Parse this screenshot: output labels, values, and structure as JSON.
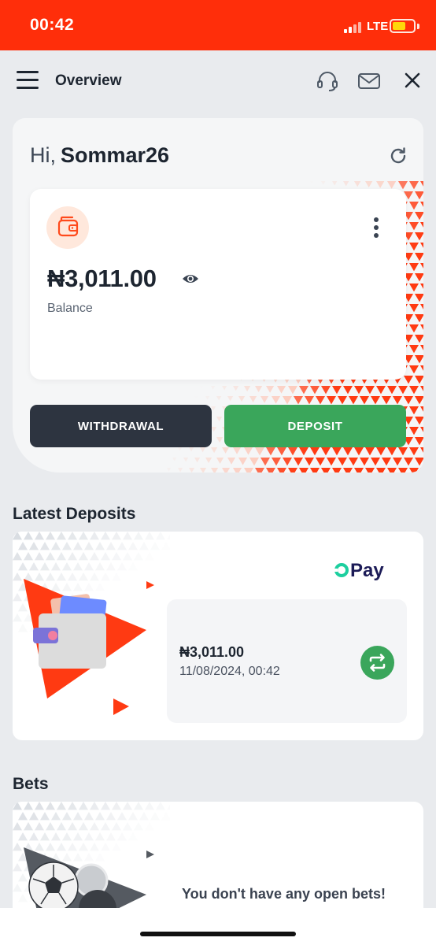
{
  "status_bar": {
    "time": "00:42",
    "network": "LTE",
    "background_color": "#ff2e0a",
    "battery_color": "#ffd60a"
  },
  "nav": {
    "title": "Overview",
    "icons": [
      "menu-icon",
      "headset-icon",
      "mail-icon",
      "close-icon"
    ]
  },
  "greeting": {
    "hi": "Hi,",
    "username": "Sommar26"
  },
  "balance": {
    "amount": "₦3,011.00",
    "label": "Balance",
    "icons": [
      "wallet-icon",
      "more-vertical-icon",
      "eye-icon",
      "refresh-icon"
    ]
  },
  "actions": {
    "withdrawal_label": "WITHDRAWAL",
    "deposit_label": "DEPOSIT",
    "withdrawal_color": "#2d3440",
    "deposit_color": "#3aa65b"
  },
  "latest_deposits": {
    "title": "Latest Deposits",
    "items": [
      {
        "provider": "Pay",
        "amount": "₦3,011.00",
        "datetime": "11/08/2024, 00:42",
        "icon": "repeat-icon"
      }
    ]
  },
  "bets": {
    "title": "Bets",
    "empty_message": "You don't have any open bets!"
  },
  "colors": {
    "accent": "#ff3a12",
    "page_background": "#e9ebee"
  }
}
